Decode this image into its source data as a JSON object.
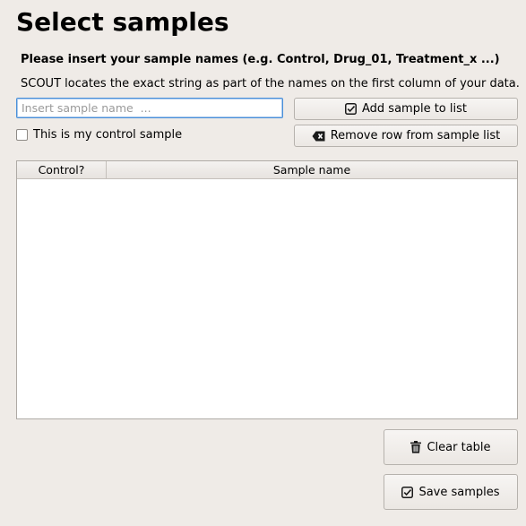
{
  "header": {
    "title": "Select samples",
    "instruction": "Please insert your sample names (e.g. Control, Drug_01, Treatment_x ...)",
    "description": "SCOUT locates the exact string as part of the names on the first column of your data."
  },
  "input": {
    "placeholder": "Insert sample name  ...",
    "value": ""
  },
  "buttons": {
    "add": "Add sample to list",
    "remove": "Remove row from sample list",
    "clear": "Clear table",
    "save": "Save samples"
  },
  "control_checkbox": {
    "label": "This is my control sample",
    "checked": false
  },
  "table": {
    "columns": [
      "Control?",
      "Sample name"
    ],
    "rows": []
  },
  "icons": {
    "add": "checkbox-check-icon",
    "remove": "backspace-icon",
    "clear": "trash-icon",
    "save": "checkbox-check-icon"
  }
}
